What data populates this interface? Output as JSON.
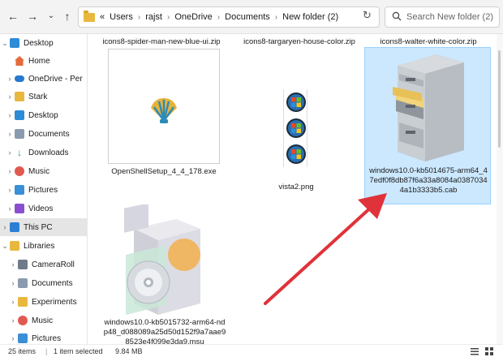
{
  "address": {
    "overflow": "«",
    "crumbs": [
      "Users",
      "rajst",
      "OneDrive",
      "Documents",
      "New folder (2)"
    ]
  },
  "search": {
    "placeholder": "Search New folder (2)"
  },
  "sidebar": {
    "items": [
      {
        "label": "Desktop",
        "icon": "desktop-icon"
      },
      {
        "label": "Home",
        "icon": "home-icon"
      },
      {
        "label": "OneDrive - Per",
        "icon": "cloud-icon"
      },
      {
        "label": "Stark",
        "icon": "folder-icon"
      },
      {
        "label": "Desktop",
        "icon": "desktop-icon"
      },
      {
        "label": "Documents",
        "icon": "documents-icon"
      },
      {
        "label": "Downloads",
        "icon": "download-icon"
      },
      {
        "label": "Music",
        "icon": "music-icon"
      },
      {
        "label": "Pictures",
        "icon": "pictures-icon"
      },
      {
        "label": "Videos",
        "icon": "videos-icon"
      },
      {
        "label": "This PC",
        "icon": "pc-icon"
      },
      {
        "label": "Libraries",
        "icon": "libraries-icon"
      },
      {
        "label": "CameraRoll",
        "icon": "camera-icon"
      },
      {
        "label": "Documents",
        "icon": "documents-icon"
      },
      {
        "label": "Experiments",
        "icon": "folder-icon"
      },
      {
        "label": "Music",
        "icon": "music-icon"
      },
      {
        "label": "Pictures",
        "icon": "pictures-icon"
      }
    ]
  },
  "files": {
    "top_row": [
      "icons8-spider-man-new-blue-ui.zip",
      "icons8-targaryen-house-color.zip",
      "icons8-walter-white-color.zip"
    ],
    "openshell": "OpenShellSetup_4_4_178.exe",
    "vista": "vista2.png",
    "cab": "windows10.0-kb5014675-arm64_47edf0f8db87f6a33a8084a03870344a1b3333b5.cab",
    "msu": "windows10.0-kb5015732-arm64-ndp48_d088089a25d50d152f9a7aae98523e4f099e3da9.msu"
  },
  "status": {
    "items": "25 items",
    "selected": "1 item selected",
    "size": "9.84 MB"
  },
  "colors": {
    "selection": "#cce8ff",
    "arrow": "#e0323a",
    "accent": "#0067c0"
  }
}
